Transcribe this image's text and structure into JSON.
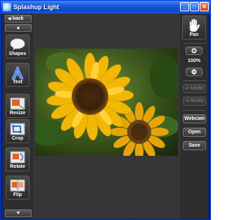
{
  "window": {
    "title": "Splashup Light"
  },
  "titlebar_buttons": {
    "minimize": "_",
    "maximize": "□",
    "close": "✕"
  },
  "sidebar": {
    "back_label": "back",
    "tools": [
      {
        "label": "Shapes",
        "icon": "speech-bubble-icon"
      },
      {
        "label": "Text",
        "icon": "letter-a-icon"
      },
      {
        "label": "Resize",
        "icon": "resize-icon"
      },
      {
        "label": "Crop",
        "icon": "crop-icon"
      },
      {
        "label": "Rotate",
        "icon": "rotate-icon"
      },
      {
        "label": "Flip",
        "icon": "flip-icon"
      }
    ]
  },
  "right": {
    "pan_label": "Pan",
    "zoom_level": "100%",
    "undo_label": "Undo",
    "redo_label": "Redo",
    "webcam_label": "Webcam",
    "open_label": "Open",
    "save_label": "Save"
  },
  "colors": {
    "titlebar": "#1658d8",
    "panel": "#2e2e2e",
    "accent_petal": "#f2b705"
  }
}
